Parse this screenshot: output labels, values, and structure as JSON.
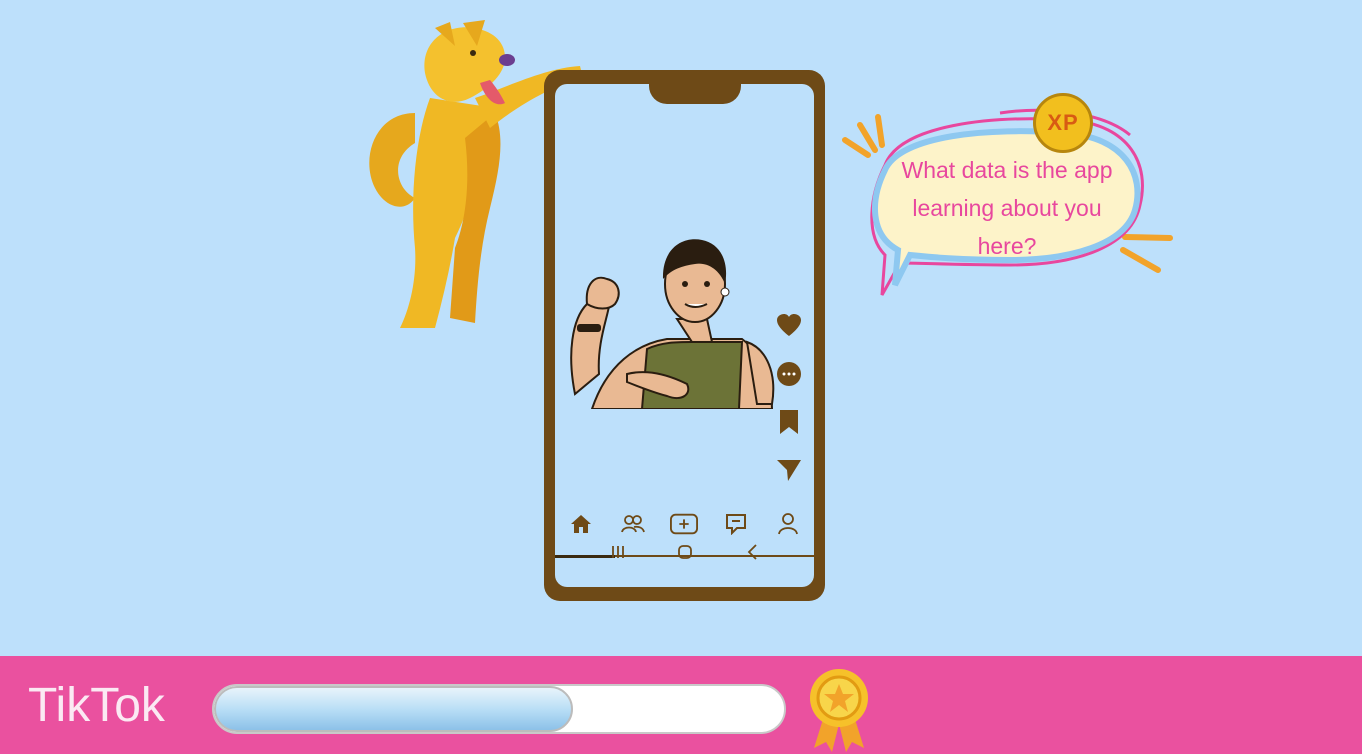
{
  "lesson": {
    "app_name": "TikTok",
    "progress_fraction": 0.63
  },
  "speech_bubble": {
    "question": "What data is the app learning about you here?",
    "xp_badge": "XP"
  },
  "phone": {
    "video_progress_fraction": 0.23,
    "nav_icons": [
      "home-icon",
      "friends-icon",
      "create-icon",
      "inbox-icon",
      "profile-icon"
    ],
    "side_actions": [
      "like-icon",
      "comment-icon",
      "bookmark-icon",
      "share-icon"
    ],
    "system_buttons": [
      "recents-icon",
      "home-button-icon",
      "back-icon"
    ]
  },
  "colors": {
    "background": "#bde0fb",
    "bottom_bar": "#ea519f",
    "phone_frame": "#6e4a17",
    "bubble_text": "#e8479e",
    "progress_fill": "#b5dcf5"
  }
}
